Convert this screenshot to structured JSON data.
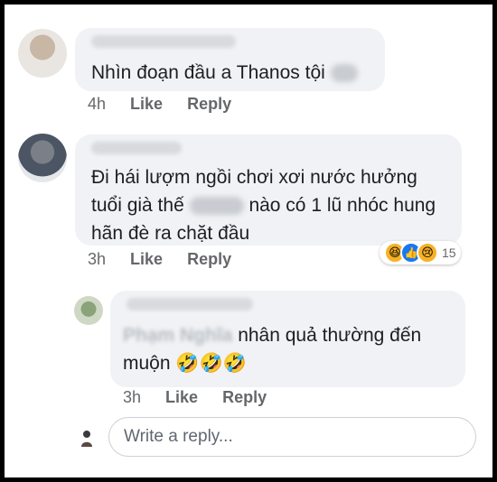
{
  "comments": [
    {
      "text": "Nhìn đoạn đầu a Thanos tội",
      "time": "4h",
      "like_label": "Like",
      "reply_label": "Reply"
    },
    {
      "text_before_blur": "Đi hái lượm ngồi chơi xơi nước hưởng tuổi già thế",
      "text_after_blur": "nào có 1 lũ nhóc hung hãn đè ra chặt đầu",
      "time": "3h",
      "like_label": "Like",
      "reply_label": "Reply",
      "reactions": {
        "count": "15",
        "icons": [
          "haha-icon",
          "like-icon",
          "sad-icon"
        ]
      }
    }
  ],
  "reply": {
    "mention": "Phạm Nghĩa",
    "text_line1": "nhân quả thường đến",
    "text_line2": "muộn",
    "emoji": "🤣🤣🤣",
    "time": "3h",
    "like_label": "Like",
    "reply_label": "Reply"
  },
  "reply_box": {
    "placeholder": "Write a reply..."
  },
  "colors": {
    "bubble": "#f0f2f5",
    "meta_text": "#65676b",
    "like_blue": "#1877f2",
    "haha_yellow": "#f7b125"
  }
}
